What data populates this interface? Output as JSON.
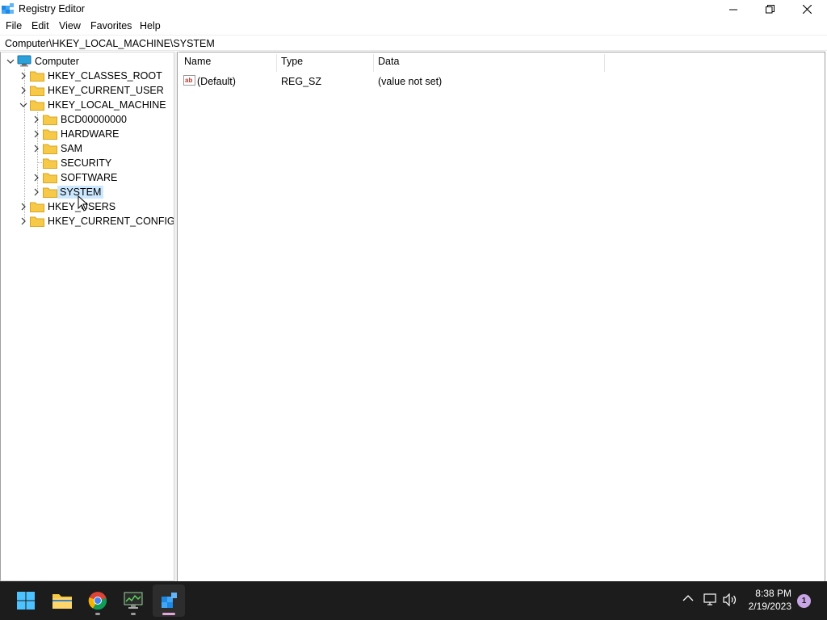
{
  "window": {
    "title": "Registry Editor"
  },
  "menu": {
    "items": [
      {
        "label": "File"
      },
      {
        "label": "Edit"
      },
      {
        "label": "View"
      },
      {
        "label": "Favorites"
      },
      {
        "label": "Help"
      }
    ]
  },
  "address": {
    "path": "Computer\\HKEY_LOCAL_MACHINE\\SYSTEM"
  },
  "tree": {
    "root": "Computer",
    "hives": [
      {
        "label": "HKEY_CLASSES_ROOT",
        "expanded": false
      },
      {
        "label": "HKEY_CURRENT_USER",
        "expanded": false
      },
      {
        "label": "HKEY_LOCAL_MACHINE",
        "expanded": true
      },
      {
        "label": "HKEY_USERS",
        "expanded": false
      },
      {
        "label": "HKEY_CURRENT_CONFIG",
        "expanded": false
      }
    ],
    "hklm_children": [
      {
        "label": "BCD00000000",
        "has_children": true
      },
      {
        "label": "HARDWARE",
        "has_children": true
      },
      {
        "label": "SAM",
        "has_children": true
      },
      {
        "label": "SECURITY",
        "has_children": false
      },
      {
        "label": "SOFTWARE",
        "has_children": true
      },
      {
        "label": "SYSTEM",
        "has_children": true,
        "selected": true
      }
    ]
  },
  "list": {
    "columns": [
      "Name",
      "Type",
      "Data"
    ],
    "rows": [
      {
        "name": "(Default)",
        "type": "REG_SZ",
        "data": "(value not set)",
        "icon": "string-value-icon"
      }
    ]
  },
  "taskbar": {
    "apps": [
      {
        "name": "start-button",
        "icon": "windows-logo-icon"
      },
      {
        "name": "file-explorer",
        "icon": "folder-icon"
      },
      {
        "name": "chrome",
        "icon": "chrome-icon"
      },
      {
        "name": "terminal-app",
        "icon": "monitor-icon"
      },
      {
        "name": "registry-editor",
        "icon": "regedit-icon",
        "active": true
      }
    ],
    "clock_time": "8:38 PM",
    "clock_date": "2/19/2023",
    "notification_count": "1"
  },
  "colors": {
    "selection": "#cce8ff",
    "taskbar": "#1c1c1c",
    "folder": "#f7c948",
    "accent": "#0078d4"
  }
}
